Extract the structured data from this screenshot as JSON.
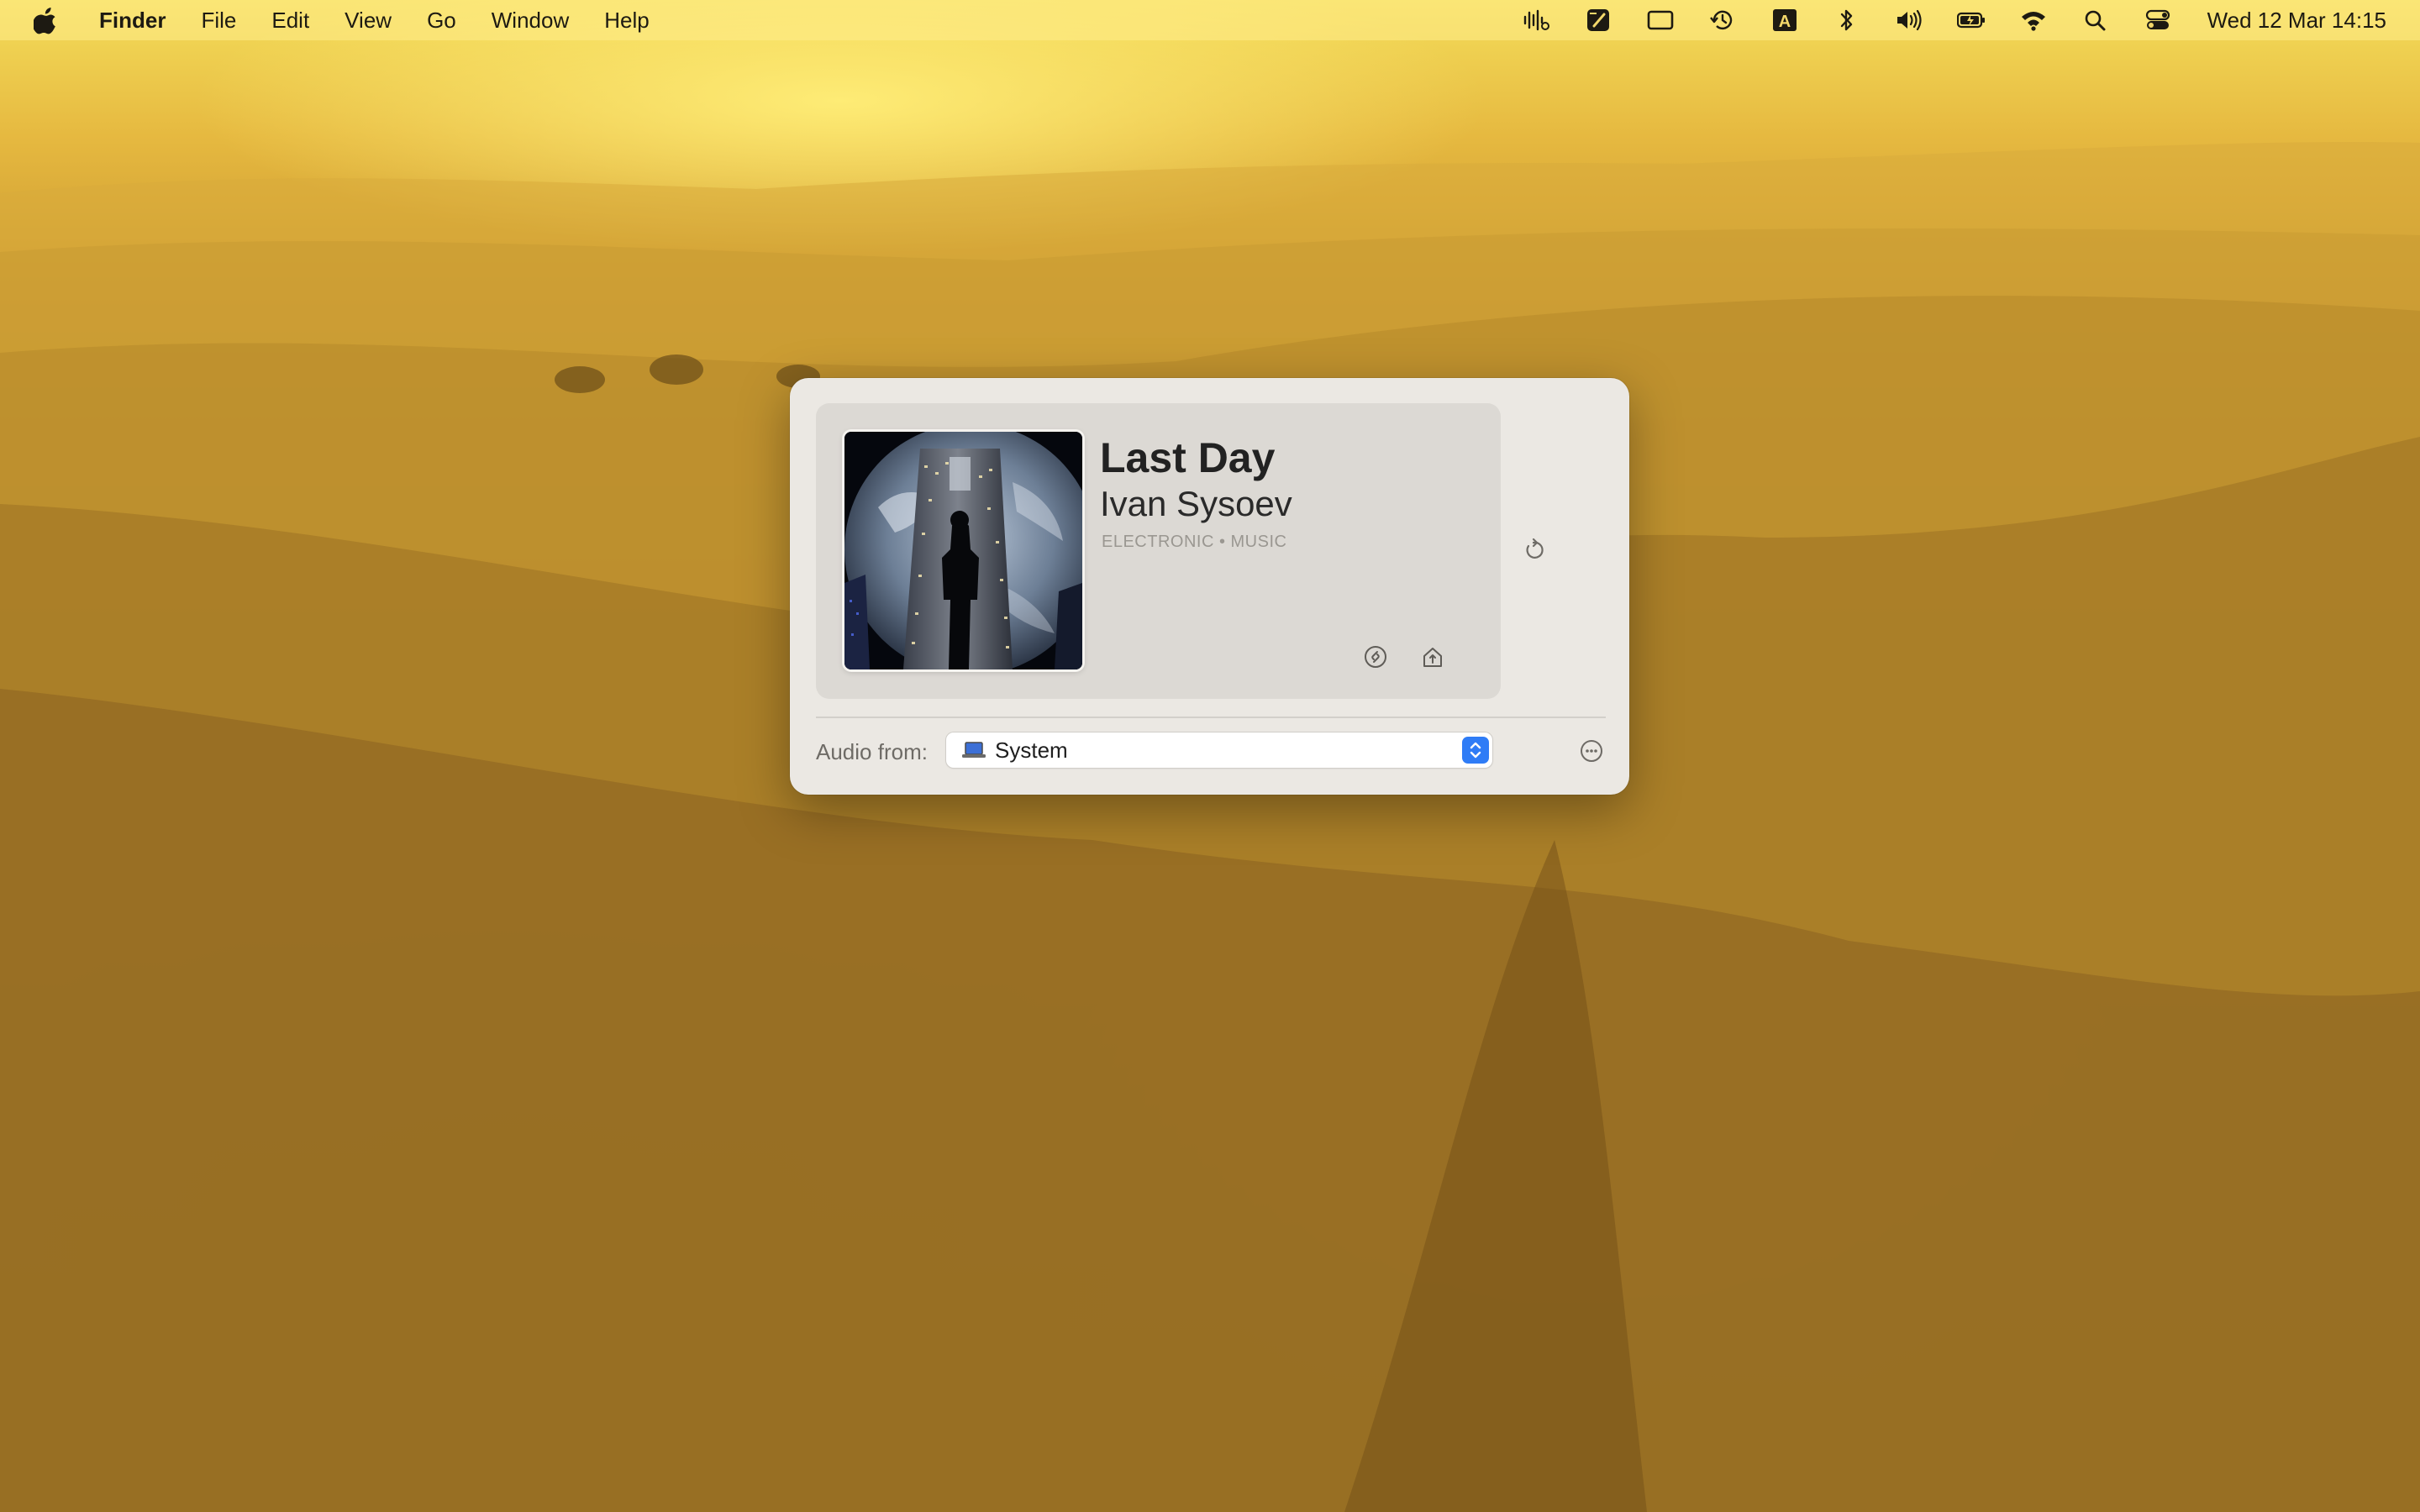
{
  "menubar": {
    "apple_icon": "apple-logo-icon",
    "app_name": "Finder",
    "menus": [
      "File",
      "Edit",
      "View",
      "Go",
      "Window",
      "Help"
    ],
    "status_icons": [
      "audio-waveform-icon",
      "notes-icon",
      "screen-mirroring-icon",
      "time-machine-icon",
      "input-source-icon",
      "bluetooth-icon",
      "volume-icon",
      "battery-icon",
      "wifi-icon",
      "spotlight-search-icon",
      "control-center-icon"
    ],
    "input_source_letter": "A",
    "clock": "Wed 12 Mar  14:15"
  },
  "widget": {
    "track": {
      "title": "Last Day",
      "artist": "Ivan Sysoev",
      "genre": "ELECTRONIC • MUSIC",
      "artwork": "album-artwork-image"
    },
    "card_buttons": [
      "shazam-icon",
      "home-share-icon"
    ],
    "refresh_icon": "refresh-icon",
    "audio_source": {
      "label": "Audio from:",
      "value": "System",
      "icon": "laptop-icon"
    },
    "more_icon": "more-ellipsis-icon",
    "accent_color": "#2f7cf6"
  }
}
